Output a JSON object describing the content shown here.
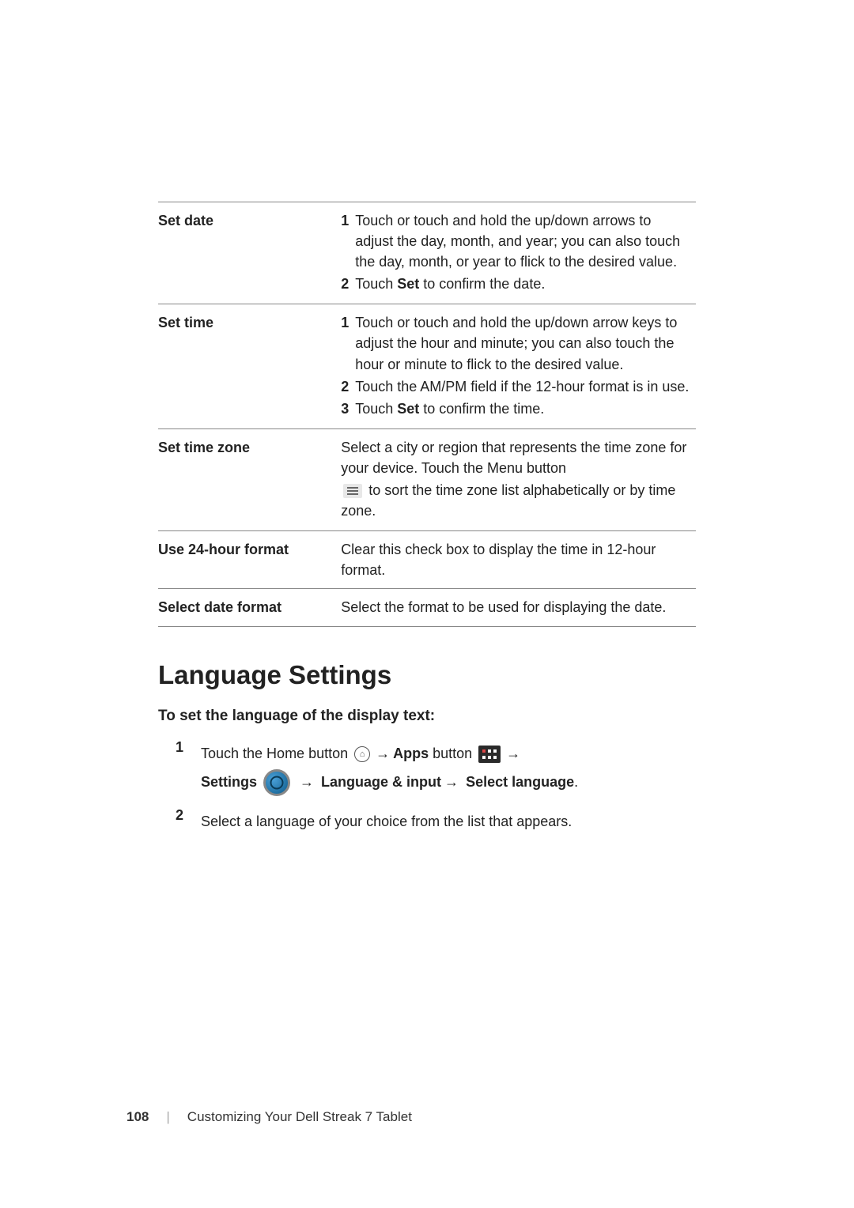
{
  "table": {
    "rows": [
      {
        "label": "Set date",
        "items": [
          {
            "num": "1",
            "text": "Touch or touch and hold the up/down arrows to adjust the day, month, and year; you can also touch the day, month, or year to flick to the desired value."
          },
          {
            "num": "2",
            "pre": "Touch ",
            "bold": "Set",
            "post": " to confirm the date."
          }
        ]
      },
      {
        "label": "Set time",
        "items": [
          {
            "num": "1",
            "text": "Touch or touch and hold the up/down arrow keys to adjust the hour and minute; you can also touch the hour or minute to flick to the desired value."
          },
          {
            "num": "2",
            "text": "Touch the AM/PM field if the 12-hour format is in use."
          },
          {
            "num": "3",
            "pre": "Touch ",
            "bold": "Set",
            "post": " to confirm the time."
          }
        ]
      },
      {
        "label": "Set time zone",
        "plain1": "Select a city or region that represents the time zone for your device. Touch the Menu button",
        "plain2_post": " to sort the time zone list alphabetically or by time zone."
      },
      {
        "label": "Use 24-hour format",
        "plain": "Clear this check box to display the time in 12-hour format."
      },
      {
        "label": "Select date format",
        "plain": "Select the format to be used for displaying the date."
      }
    ]
  },
  "heading": "Language Settings",
  "subheading": "To set the language of the display text:",
  "steps": [
    {
      "num": "1",
      "line1_pre": "Touch the Home button ",
      "apps_label": "Apps",
      "line1_mid": " button ",
      "line2_pre": "Settings ",
      "line2_path1": "Language & input",
      "line2_path2": "Select language",
      "period": "."
    },
    {
      "num": "2",
      "text": "Select a language of your choice from the list that appears."
    }
  ],
  "footer": {
    "page": "108",
    "title": "Customizing Your Dell Streak 7 Tablet"
  },
  "arrow": "→"
}
